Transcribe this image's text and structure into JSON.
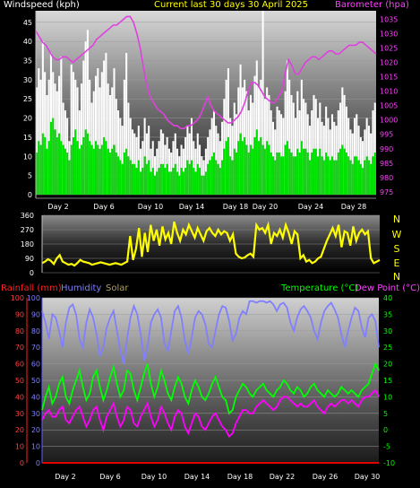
{
  "header": {
    "wind_label": "Windspeed (kph)",
    "title": "Current last 30 days 30 April 2025",
    "baro_label": "Barometer (hpa)"
  },
  "bottom_header": {
    "rain_label": "Rainfall (mm)",
    "hum_label": "Humidity",
    "solar_label": "Solar",
    "temp_label": "Temperature (°C)",
    "dew_label": "Dew Point (°C)"
  },
  "colors": {
    "wind_gust": "#ffffff",
    "wind_avg": "#00e000",
    "barometer": "#e040e0",
    "direction": "#ffff00",
    "humidity": "#8080ff",
    "temperature": "#00ff00",
    "dewpoint": "#ff00ff",
    "rainfall": "#ff0000",
    "solar": "#c0c000"
  },
  "chart_data": [
    {
      "type": "bar",
      "name": "wind-and-barometer",
      "x_ticks": [
        "Day 2",
        "Day 6",
        "Day 10",
        "Day 14",
        "Day 18",
        "Day 20",
        "Day 24",
        "Day 28"
      ],
      "y_left": {
        "label": "Windspeed (kph)",
        "ticks": [
          0,
          5,
          10,
          15,
          20,
          25,
          30,
          35,
          40,
          45
        ],
        "range": [
          0,
          48
        ]
      },
      "y_right": {
        "label": "Barometer (hpa)",
        "ticks": [
          975,
          980,
          985,
          990,
          995,
          1000,
          1005,
          1010,
          1015,
          1020,
          1025,
          1030,
          1035
        ],
        "range": [
          974,
          1038
        ]
      },
      "series": [
        {
          "name": "gust",
          "values": [
            28,
            33,
            30,
            40,
            32,
            26,
            30,
            37,
            32,
            29,
            27,
            31,
            36,
            24,
            22,
            20,
            14,
            34,
            32,
            30,
            28,
            22,
            29,
            35,
            40,
            43,
            30,
            24,
            27,
            31,
            33,
            28,
            32,
            35,
            37,
            29,
            26,
            28,
            33,
            25,
            22,
            20,
            18,
            30,
            37,
            24,
            20,
            17,
            16,
            15,
            18,
            12,
            14,
            20,
            16,
            18,
            12,
            14,
            10,
            12,
            14,
            17,
            16,
            13,
            15,
            12,
            11,
            14,
            16,
            12,
            10,
            13,
            12,
            15,
            18,
            16,
            20,
            14,
            12,
            16,
            13,
            10,
            9,
            12,
            15,
            17,
            20,
            22,
            18,
            16,
            14,
            19,
            25,
            30,
            33,
            20,
            18,
            24,
            21,
            28,
            34,
            28,
            30,
            27,
            22,
            26,
            24,
            31,
            35,
            28,
            30,
            48,
            25,
            28,
            26,
            22,
            19,
            17,
            23,
            22,
            21,
            20,
            27,
            35,
            30,
            26,
            24,
            20,
            27,
            22,
            30,
            25,
            24,
            21,
            18,
            22,
            26,
            25,
            20,
            24,
            19,
            18,
            23,
            20,
            17,
            21,
            19,
            18,
            22,
            24,
            28,
            26,
            23,
            20,
            17,
            16,
            20,
            21,
            18,
            15,
            14,
            17,
            20,
            18,
            16,
            22,
            24
          ]
        },
        {
          "name": "average",
          "values": [
            11,
            14,
            13,
            16,
            15,
            12,
            14,
            19,
            20,
            17,
            15,
            16,
            14,
            13,
            12,
            11,
            9,
            13,
            15,
            17,
            14,
            12,
            13,
            15,
            17,
            16,
            14,
            13,
            12,
            14,
            13,
            12,
            13,
            15,
            14,
            12,
            11,
            12,
            13,
            11,
            10,
            9,
            8,
            11,
            12,
            10,
            9,
            8,
            8,
            7,
            9,
            6,
            7,
            10,
            8,
            9,
            6,
            7,
            5,
            6,
            7,
            8,
            8,
            7,
            8,
            6,
            6,
            7,
            8,
            6,
            5,
            7,
            6,
            7,
            9,
            8,
            9,
            7,
            6,
            8,
            7,
            5,
            5,
            6,
            8,
            9,
            10,
            11,
            9,
            8,
            7,
            9,
            12,
            14,
            15,
            10,
            9,
            12,
            11,
            14,
            16,
            14,
            15,
            13,
            11,
            13,
            12,
            15,
            17,
            14,
            15,
            13,
            12,
            14,
            13,
            11,
            10,
            9,
            11,
            11,
            10,
            10,
            13,
            14,
            12,
            11,
            10,
            10,
            12,
            11,
            14,
            12,
            12,
            11,
            9,
            11,
            12,
            12,
            10,
            12,
            10,
            9,
            11,
            10,
            9,
            10,
            9,
            9,
            11,
            12,
            13,
            12,
            11,
            10,
            9,
            8,
            10,
            10,
            9,
            8,
            7,
            9,
            10,
            9,
            8,
            10,
            11
          ]
        },
        {
          "name": "barometer",
          "values": [
            1031,
            1029,
            1027,
            1026,
            1024,
            1022,
            1021,
            1021,
            1022,
            1022,
            1021,
            1020,
            1021,
            1022,
            1023,
            1024,
            1025,
            1026,
            1028,
            1029,
            1030,
            1031,
            1032,
            1033,
            1033,
            1034,
            1035,
            1036,
            1036,
            1034,
            1030,
            1025,
            1018,
            1012,
            1008,
            1006,
            1004,
            1003,
            1002,
            1000,
            999,
            998,
            998,
            997,
            997,
            998,
            998,
            999,
            1000,
            1002,
            1005,
            1008,
            1005,
            1003,
            1002,
            1001,
            1000,
            999,
            999,
            1000,
            1001,
            1003,
            1006,
            1010,
            1013,
            1013,
            1012,
            1010,
            1008,
            1007,
            1006,
            1006,
            1008,
            1010,
            1016,
            1021,
            1019,
            1016,
            1016,
            1018,
            1020,
            1021,
            1022,
            1022,
            1021,
            1022,
            1023,
            1024,
            1024,
            1023,
            1023,
            1024,
            1025,
            1026,
            1026,
            1026,
            1027,
            1027,
            1026,
            1025,
            1024,
            1023
          ]
        }
      ]
    },
    {
      "type": "line",
      "name": "wind-direction",
      "x_ticks": [
        "Day 2",
        "Day 6",
        "Day 10",
        "Day 14",
        "Day 18",
        "Day 20",
        "Day 24",
        "Day 28"
      ],
      "y_left": {
        "ticks": [
          0,
          90,
          180,
          270,
          360
        ],
        "range": [
          0,
          360
        ]
      },
      "y_right": {
        "ticks": [
          "N",
          "W",
          "S",
          "E",
          "N"
        ]
      },
      "series": [
        {
          "name": "direction",
          "values": [
            60,
            70,
            85,
            75,
            55,
            90,
            110,
            70,
            60,
            50,
            55,
            45,
            60,
            80,
            70,
            65,
            60,
            50,
            55,
            60,
            65,
            60,
            55,
            50,
            55,
            60,
            55,
            50,
            60,
            70,
            230,
            80,
            150,
            280,
            100,
            250,
            130,
            300,
            200,
            270,
            170,
            290,
            210,
            250,
            180,
            320,
            250,
            200,
            270,
            240,
            300,
            260,
            220,
            280,
            240,
            200,
            260,
            280,
            250,
            230,
            270,
            240,
            260,
            250,
            200,
            240,
            120,
            100,
            90,
            95,
            110,
            120,
            100,
            300,
            270,
            280,
            250,
            300,
            180,
            250,
            230,
            270,
            220,
            300,
            250,
            180,
            260,
            240,
            90,
            110,
            70,
            80,
            60,
            70,
            90,
            100,
            150,
            200,
            240,
            280,
            230,
            300,
            160,
            260,
            250,
            170,
            290,
            200,
            250,
            270,
            240,
            260,
            90,
            60,
            70,
            80
          ]
        }
      ]
    },
    {
      "type": "line",
      "name": "temperature-humidity-rainfall",
      "x_ticks": [
        "Day 2",
        "Day 6",
        "Day 10",
        "Day 14",
        "Day 18",
        "Day 22",
        "Day 26",
        "Day 30"
      ],
      "y_left": {
        "label": "Rainfall (mm)",
        "ticks": [
          0,
          10,
          20,
          30,
          40,
          50,
          60,
          70,
          80,
          90,
          100
        ],
        "range": [
          0,
          100
        ]
      },
      "y_right": {
        "label": "Temperature (°C)",
        "ticks": [
          -10,
          -5,
          0,
          5,
          10,
          15,
          20,
          25,
          30,
          35,
          40
        ],
        "range": [
          -10,
          40
        ]
      },
      "series": [
        {
          "name": "Humidity",
          "values": [
            92,
            85,
            75,
            90,
            88,
            80,
            70,
            85,
            94,
            96,
            90,
            75,
            70,
            85,
            93,
            88,
            78,
            65,
            70,
            82,
            88,
            92,
            80,
            68,
            60,
            75,
            88,
            95,
            90,
            78,
            62,
            70,
            85,
            90,
            93,
            88,
            72,
            68,
            80,
            92,
            95,
            88,
            74,
            66,
            76,
            88,
            92,
            90,
            84,
            72,
            70,
            80,
            90,
            95,
            94,
            86,
            74,
            78,
            88,
            92,
            90,
            98,
            98,
            97,
            98,
            98,
            97,
            98,
            96,
            92,
            96,
            97,
            94,
            85,
            80,
            88,
            93,
            95,
            92,
            88,
            80,
            75,
            85,
            92,
            95,
            97,
            93,
            88,
            78,
            70,
            80,
            88,
            94,
            92,
            82,
            76,
            88,
            90,
            86,
            70
          ]
        },
        {
          "name": "Temperature (°C)",
          "values": [
            6,
            10,
            13,
            8,
            10,
            14,
            16,
            10,
            8,
            12,
            15,
            18,
            13,
            9,
            11,
            16,
            18,
            13,
            9,
            12,
            16,
            19,
            14,
            10,
            12,
            18,
            17,
            12,
            9,
            13,
            17,
            20,
            14,
            10,
            13,
            18,
            15,
            11,
            9,
            13,
            16,
            14,
            10,
            8,
            12,
            15,
            13,
            10,
            9,
            11,
            14,
            16,
            13,
            10,
            9,
            5,
            6,
            10,
            12,
            14,
            13,
            11,
            10,
            12,
            13,
            14,
            12,
            11,
            10,
            12,
            13,
            15,
            14,
            12,
            11,
            13,
            12,
            10,
            11,
            13,
            14,
            12,
            11,
            10,
            12,
            11,
            10,
            11,
            13,
            12,
            11,
            12,
            11,
            10,
            12,
            13,
            14,
            17,
            20,
            18
          ]
        },
        {
          "name": "Dew Point (°C)",
          "values": [
            3,
            5,
            6,
            4,
            4,
            6,
            7,
            3,
            2,
            4,
            6,
            7,
            4,
            1,
            3,
            6,
            7,
            3,
            0,
            4,
            6,
            8,
            4,
            1,
            3,
            7,
            6,
            2,
            1,
            4,
            6,
            8,
            4,
            1,
            3,
            7,
            5,
            2,
            0,
            4,
            6,
            5,
            1,
            -1,
            2,
            5,
            4,
            1,
            0,
            2,
            4,
            5,
            3,
            1,
            0,
            -2,
            -1,
            2,
            4,
            6,
            6,
            5,
            5,
            7,
            8,
            9,
            8,
            7,
            6,
            7,
            9,
            10,
            10,
            9,
            8,
            7,
            8,
            7,
            7,
            8,
            9,
            7,
            6,
            5,
            7,
            8,
            7,
            8,
            9,
            9,
            8,
            9,
            8,
            7,
            9,
            10,
            10,
            11,
            12,
            10
          ]
        },
        {
          "name": "Rainfall (mm)",
          "values": [
            0,
            0,
            0,
            0,
            0,
            0,
            0,
            0,
            0,
            0,
            0,
            0,
            0,
            0,
            0,
            0,
            0,
            0,
            0,
            0,
            0,
            0,
            0,
            0,
            0,
            0,
            0,
            0,
            0,
            0,
            0,
            0,
            0,
            0,
            0,
            0,
            0,
            0,
            0,
            0,
            0,
            0,
            0,
            0,
            0,
            0,
            0,
            0,
            0,
            0,
            0,
            0,
            0,
            0,
            0,
            0,
            0,
            0,
            0,
            0,
            0,
            0,
            0,
            0,
            0,
            0,
            0,
            0,
            0,
            0,
            0,
            0,
            0,
            0,
            0,
            0,
            0,
            0,
            0,
            0,
            0,
            0,
            0,
            0,
            0,
            0,
            0,
            0,
            0,
            0,
            0,
            0,
            0,
            0,
            0,
            0,
            0,
            0,
            0,
            0
          ]
        }
      ]
    }
  ]
}
